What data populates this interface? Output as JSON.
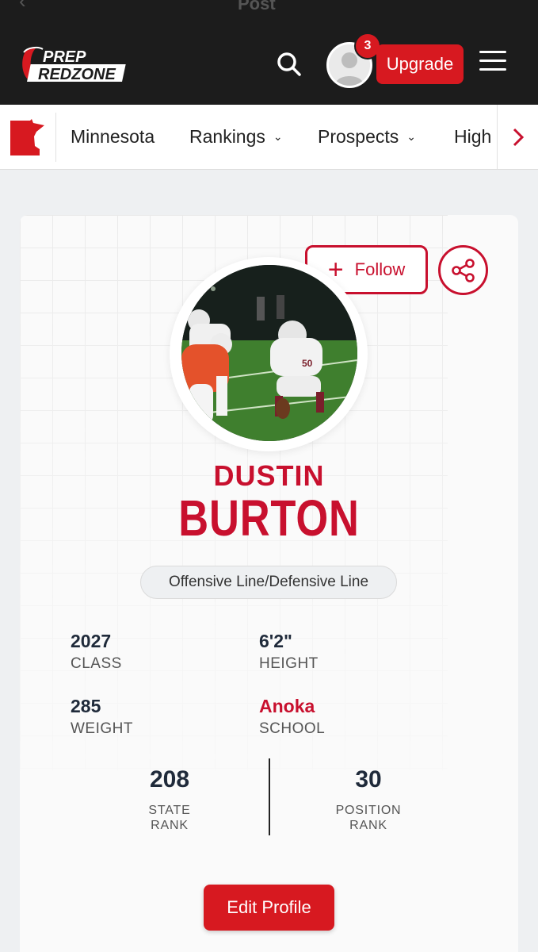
{
  "header": {
    "ghost_text": "Post",
    "logo_line1": "PREP",
    "logo_line2": "REDZONE",
    "notification_count": "3",
    "upgrade_label": "Upgrade"
  },
  "nav": {
    "state": "Minnesota",
    "items": [
      "Rankings",
      "Prospects",
      "High"
    ]
  },
  "profile": {
    "follow_label": "Follow",
    "first_name": "DUSTIN",
    "last_name": "BURTON",
    "position": "Offensive Line/Defensive Line",
    "stats": [
      {
        "value": "2027",
        "label": "CLASS"
      },
      {
        "value": "6'2\"",
        "label": "HEIGHT"
      },
      {
        "value": "285",
        "label": "WEIGHT"
      },
      {
        "value": "Anoka",
        "label": "SCHOOL"
      }
    ],
    "ranks": [
      {
        "value": "208",
        "label_line1": "STATE",
        "label_line2": "RANK"
      },
      {
        "value": "30",
        "label_line1": "POSITION",
        "label_line2": "RANK"
      }
    ],
    "edit_label": "Edit Profile",
    "jersey_number": "50"
  },
  "colors": {
    "brand_red": "#d71920",
    "header_bg": "#1c1c1c"
  }
}
